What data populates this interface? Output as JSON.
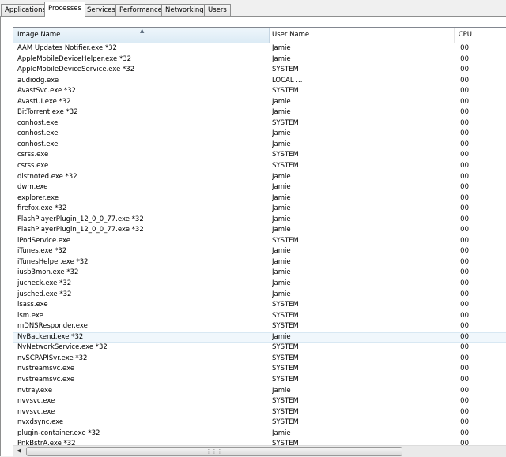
{
  "tabs": [
    {
      "label": "Applications"
    },
    {
      "label": "Processes"
    },
    {
      "label": "Services"
    },
    {
      "label": "Performance"
    },
    {
      "label": "Networking"
    },
    {
      "label": "Users"
    }
  ],
  "active_tab": "Processes",
  "columns": {
    "name": "Image Name",
    "user": "User Name",
    "cpu": "CPU"
  },
  "selected_row": "NvBackend.exe *32",
  "rows": [
    {
      "name": "AAM Updates Notifier.exe *32",
      "user": "Jamie",
      "cpu": "00"
    },
    {
      "name": "AppleMobileDeviceHelper.exe *32",
      "user": "Jamie",
      "cpu": "00"
    },
    {
      "name": "AppleMobileDeviceService.exe *32",
      "user": "SYSTEM",
      "cpu": "00"
    },
    {
      "name": "audiodg.exe",
      "user": "LOCAL ...",
      "cpu": "00"
    },
    {
      "name": "AvastSvc.exe *32",
      "user": "SYSTEM",
      "cpu": "00"
    },
    {
      "name": "AvastUI.exe *32",
      "user": "Jamie",
      "cpu": "00"
    },
    {
      "name": "BitTorrent.exe *32",
      "user": "Jamie",
      "cpu": "00"
    },
    {
      "name": "conhost.exe",
      "user": "SYSTEM",
      "cpu": "00"
    },
    {
      "name": "conhost.exe",
      "user": "Jamie",
      "cpu": "00"
    },
    {
      "name": "conhost.exe",
      "user": "Jamie",
      "cpu": "00"
    },
    {
      "name": "csrss.exe",
      "user": "SYSTEM",
      "cpu": "00"
    },
    {
      "name": "csrss.exe",
      "user": "SYSTEM",
      "cpu": "00"
    },
    {
      "name": "distnoted.exe *32",
      "user": "Jamie",
      "cpu": "00"
    },
    {
      "name": "dwm.exe",
      "user": "Jamie",
      "cpu": "00"
    },
    {
      "name": "explorer.exe",
      "user": "Jamie",
      "cpu": "00"
    },
    {
      "name": "firefox.exe *32",
      "user": "Jamie",
      "cpu": "00"
    },
    {
      "name": "FlashPlayerPlugin_12_0_0_77.exe *32",
      "user": "Jamie",
      "cpu": "00"
    },
    {
      "name": "FlashPlayerPlugin_12_0_0_77.exe *32",
      "user": "Jamie",
      "cpu": "00"
    },
    {
      "name": "iPodService.exe",
      "user": "SYSTEM",
      "cpu": "00"
    },
    {
      "name": "iTunes.exe *32",
      "user": "Jamie",
      "cpu": "00"
    },
    {
      "name": "iTunesHelper.exe *32",
      "user": "Jamie",
      "cpu": "00"
    },
    {
      "name": "iusb3mon.exe *32",
      "user": "Jamie",
      "cpu": "00"
    },
    {
      "name": "jucheck.exe *32",
      "user": "Jamie",
      "cpu": "00"
    },
    {
      "name": "jusched.exe *32",
      "user": "Jamie",
      "cpu": "00"
    },
    {
      "name": "lsass.exe",
      "user": "SYSTEM",
      "cpu": "00"
    },
    {
      "name": "lsm.exe",
      "user": "SYSTEM",
      "cpu": "00"
    },
    {
      "name": "mDNSResponder.exe",
      "user": "SYSTEM",
      "cpu": "00"
    },
    {
      "name": "NvBackend.exe *32",
      "user": "Jamie",
      "cpu": "00"
    },
    {
      "name": "NvNetworkService.exe *32",
      "user": "SYSTEM",
      "cpu": "00"
    },
    {
      "name": "nvSCPAPISvr.exe *32",
      "user": "SYSTEM",
      "cpu": "00"
    },
    {
      "name": "nvstreamsvc.exe",
      "user": "SYSTEM",
      "cpu": "00"
    },
    {
      "name": "nvstreamsvc.exe",
      "user": "SYSTEM",
      "cpu": "00"
    },
    {
      "name": "nvtray.exe",
      "user": "Jamie",
      "cpu": "00"
    },
    {
      "name": "nvvsvc.exe",
      "user": "SYSTEM",
      "cpu": "00"
    },
    {
      "name": "nvvsvc.exe",
      "user": "SYSTEM",
      "cpu": "00"
    },
    {
      "name": "nvxdsync.exe",
      "user": "SYSTEM",
      "cpu": "00"
    },
    {
      "name": "plugin-container.exe *32",
      "user": "Jamie",
      "cpu": "00"
    },
    {
      "name": "PnkBstrA.exe *32",
      "user": "SYSTEM",
      "cpu": "00"
    }
  ],
  "icons": {
    "sort": "sort-ascending-icon",
    "scroll_left": "scroll-left-arrow-icon",
    "thumb_grip": "scrollbar-grip-icon"
  }
}
